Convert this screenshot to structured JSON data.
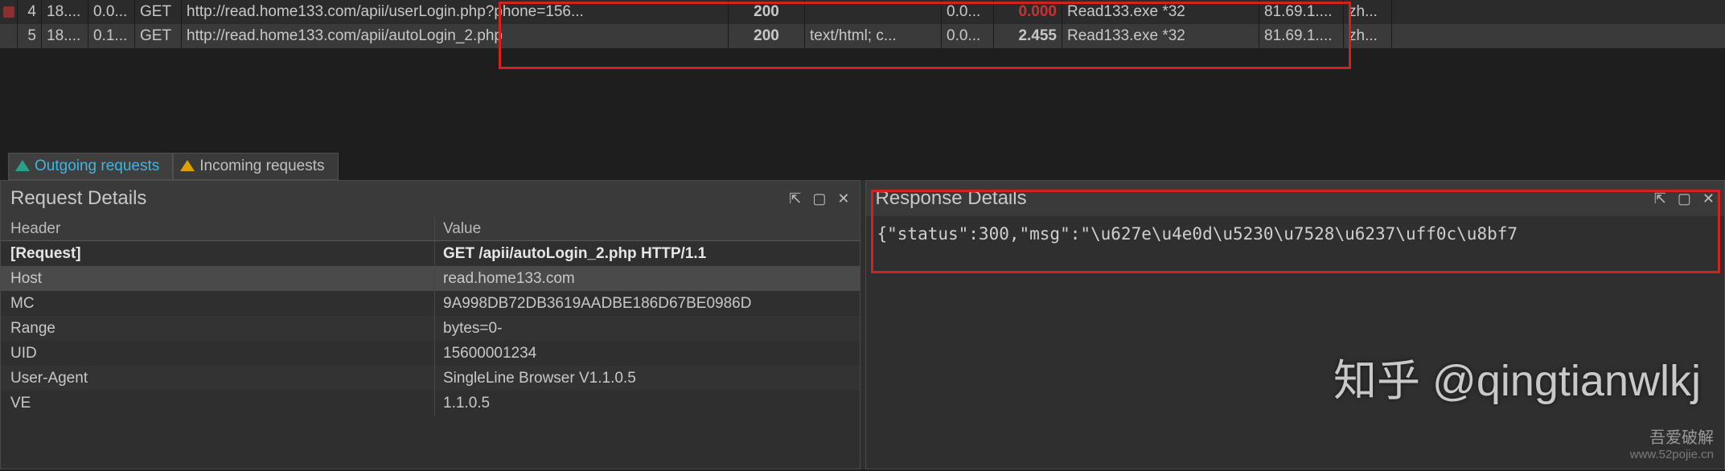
{
  "grid": {
    "rows": [
      {
        "num": "4",
        "time": "18....",
        "dur": "0.0...",
        "method": "GET",
        "url": "http://read.home133.com/apii/userLogin.php?phone=156...",
        "status": "200",
        "ctype": "",
        "sz1": "0.0...",
        "sz2": "0.000",
        "proc": "Read133.exe *32",
        "ip": "81.69.1....",
        "usr": "zh...",
        "sz2_red": true,
        "blocked": true
      },
      {
        "num": "5",
        "time": "18....",
        "dur": "0.1...",
        "method": "GET",
        "url": "http://read.home133.com/apii/autoLogin_2.php",
        "status": "200",
        "ctype": "text/html; c...",
        "sz1": "0.0...",
        "sz2": "2.455",
        "proc": "Read133.exe *32",
        "ip": "81.69.1....",
        "usr": "zh...",
        "sz2_red": false,
        "blocked": false
      }
    ]
  },
  "tabs": {
    "outgoing": "Outgoing requests",
    "incoming": "Incoming requests"
  },
  "request_panel": {
    "title": "Request Details",
    "header_name": "Header",
    "header_value": "Value",
    "rows": [
      {
        "name": "[Request]",
        "value": "GET /apii/autoLogin_2.php HTTP/1.1",
        "bold": true
      },
      {
        "name": "Host",
        "value": "read.home133.com",
        "sel": true
      },
      {
        "name": "MC",
        "value": "9A998DB72DB3619AADBE186D67BE0986D"
      },
      {
        "name": "Range",
        "value": "bytes=0-"
      },
      {
        "name": "UID",
        "value": "15600001234"
      },
      {
        "name": "User-Agent",
        "value": "SingleLine Browser V1.1.0.5"
      },
      {
        "name": "VE",
        "value": "1.1.0.5"
      }
    ]
  },
  "response_panel": {
    "title": "Response Details",
    "body": "{\"status\":300,\"msg\":\"\\u627e\\u4e0d\\u5230\\u7528\\u6237\\uff0c\\u8bf7"
  },
  "controls": {
    "pin": "⇱",
    "win": "▢",
    "close": "✕"
  },
  "watermark": {
    "main": "知乎 @qingtianwlkj",
    "sub1": "吾爱破解",
    "sub2": "www.52pojie.cn"
  }
}
